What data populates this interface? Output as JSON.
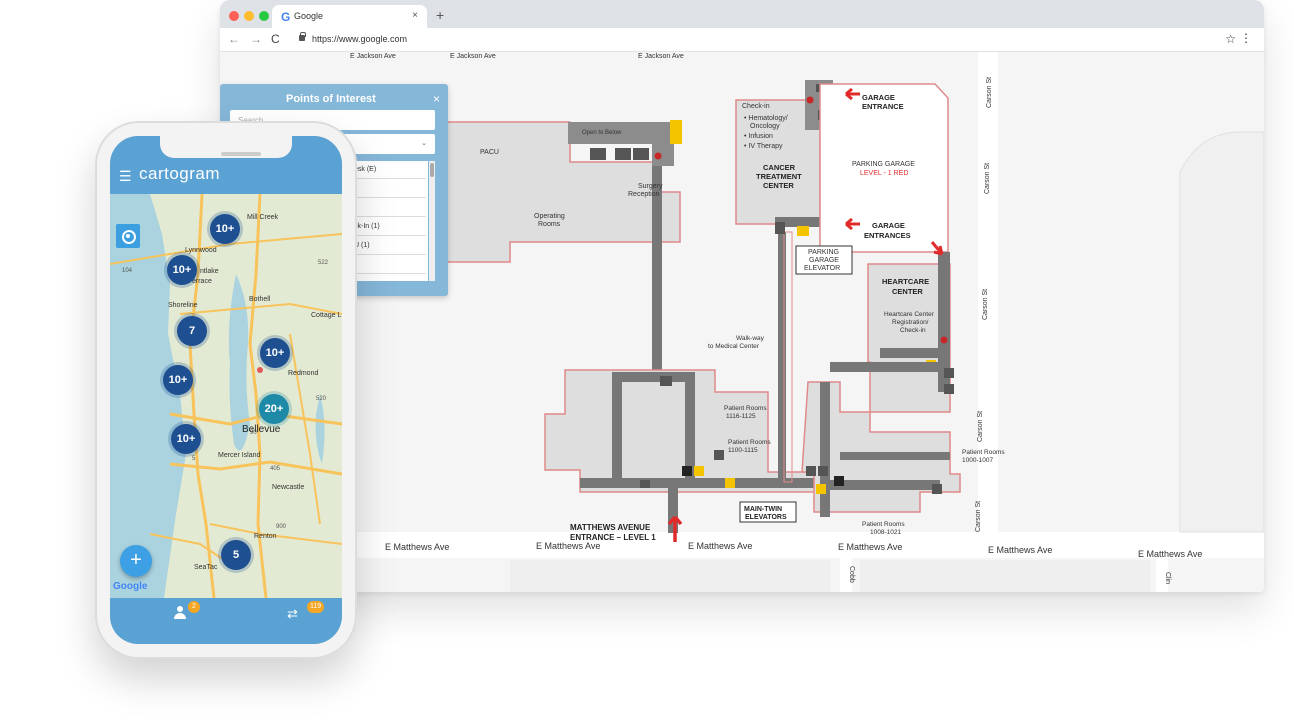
{
  "browser": {
    "tab_title": "Google",
    "tab_icon": "G",
    "tab_close": "×",
    "new_tab": "+",
    "url": "https://www.google.com",
    "nav": {
      "back": "←",
      "forward": "→",
      "reload": "C"
    },
    "star": "☆",
    "menu": "⋮"
  },
  "poi_panel": {
    "title": "Points of Interest",
    "close": "×",
    "search_placeholder": "Search",
    "select_chevron": "⌄",
    "items": [
      "esk (E)",
      "",
      "",
      "ck-In (1)",
      "U (1)",
      ""
    ]
  },
  "floorplan": {
    "streets": {
      "top": [
        "E Jackson Ave",
        "E Jackson Ave",
        "E Jackson Ave"
      ],
      "bottom": [
        "E Matthews Ave",
        "E Matthews Ave",
        "E Matthews Ave",
        "E Matthews Ave",
        "E Matthews Ave",
        "E Matthews Ave"
      ],
      "right": [
        "Carson St",
        "Carson St",
        "Carson St",
        "Carson St",
        "Carson St"
      ],
      "cobb": "Cobb",
      "clin": "Clin"
    },
    "labels": {
      "pacu": "PACU",
      "open_to_below": "Open to Below",
      "surgery_reception": [
        "Surgery",
        "Reception"
      ],
      "operating_rooms": [
        "Operating",
        "Rooms"
      ],
      "checkin_list": [
        "Check-in",
        "• Hematology/",
        "Oncology",
        "• Infusion",
        "• IV Therapy"
      ],
      "cancer_center": [
        "CANCER",
        "TREATMENT",
        "CENTER"
      ],
      "garage_entrance": [
        "GARAGE",
        "ENTRANCE"
      ],
      "parking_garage": "PARKING GARAGE",
      "parking_level": "LEVEL - 1 RED",
      "garage_entrances": [
        "GARAGE",
        "ENTRANCES"
      ],
      "parking_elevator": [
        "PARKING",
        "GARAGE",
        "ELEVATOR"
      ],
      "heartcare": [
        "HEARTCARE",
        "CENTER"
      ],
      "heartcare_reg": [
        "Heartcare Center",
        "Registration/",
        "Check-in"
      ],
      "walkway": [
        "Walk-way",
        "to Medical Center"
      ],
      "patient_rooms_1116": [
        "Patient Rooms",
        "1116-1125"
      ],
      "patient_rooms_1100": [
        "Patient Rooms",
        "1100-1115"
      ],
      "patient_rooms_1000": [
        "Patient Rooms",
        "1000-1007"
      ],
      "patient_rooms_1008": [
        "Patient Rooms",
        "1008-1021"
      ],
      "main_twin": [
        "MAIN-TWIN",
        "ELEVATORS"
      ],
      "matthews_entrance": [
        "MATTHEWS AVENUE",
        "ENTRANCE – LEVEL 1"
      ]
    }
  },
  "phone": {
    "brand": "cartogram",
    "menu_icon": "☰",
    "clusters": [
      "10+",
      "10+",
      "7",
      "10+",
      "10+",
      "20+",
      "10+",
      "5"
    ],
    "places": [
      "Mill Creek",
      "Lynnwood",
      "ntlake",
      "errace",
      "Shoreline",
      "Bothell",
      "Cottage L",
      "Redmond",
      "Bellevue",
      "Mercer Island",
      "Newcastle",
      "Renton",
      "SeaTac"
    ],
    "road_shields": [
      "104",
      "522",
      "520",
      "405",
      "900",
      "5",
      "90"
    ],
    "fab": "+",
    "google": "Google",
    "badge_user": "2",
    "badge_route": "119",
    "route_icon": "⇄"
  },
  "colors": {
    "phone_header": "#5aa1d4",
    "cluster_blue": "#1d4f91",
    "cluster_teal": "#1f8aa8",
    "accent_red": "#e02b2b",
    "badge_orange": "#f5a623"
  }
}
